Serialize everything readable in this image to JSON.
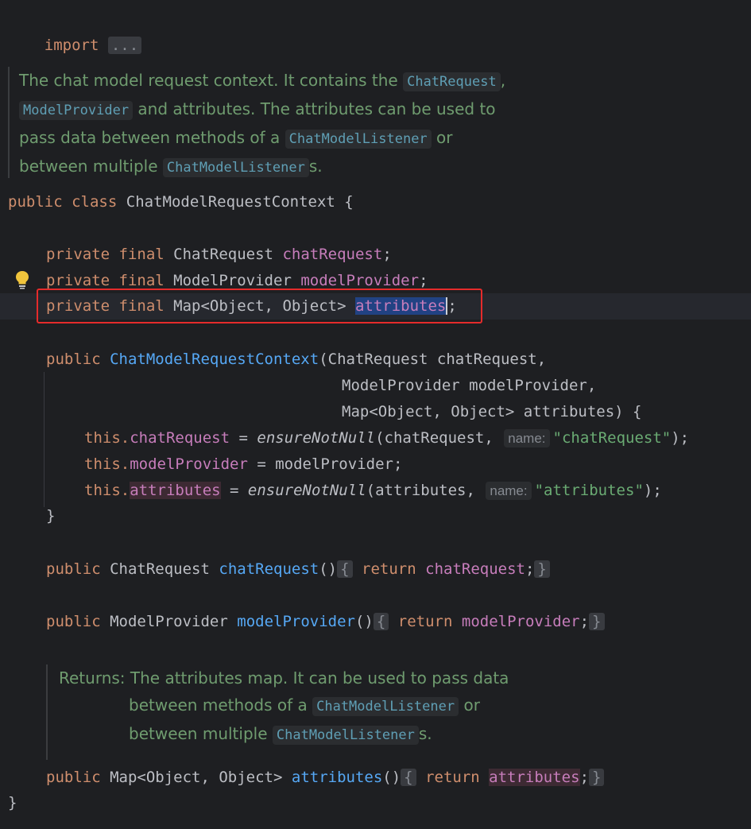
{
  "import": {
    "keyword": "import",
    "fold": "..."
  },
  "class_doc": {
    "l1": "The chat model request context. It contains the ",
    "l1_ref": "ChatRequest",
    "l1_end": ",",
    "l2_ref": "ModelProvider",
    "l2": " and attributes. The attributes can be used to",
    "l3": "pass data between methods of a ",
    "l3_ref": "ChatModelListener",
    "l3_end": " or",
    "l4": "between multiple ",
    "l4_ref": "ChatModelListener",
    "l4_end": "s."
  },
  "class_decl": {
    "kw_public": "public",
    "kw_class": "class",
    "name": "ChatModelRequestContext",
    "brace": " {"
  },
  "fields": [
    {
      "mods": "private final",
      "type": "ChatRequest",
      "name": "chatRequest"
    },
    {
      "mods": "private final",
      "type": "ModelProvider",
      "name": "modelProvider"
    },
    {
      "mods": "private final",
      "type": "Map<Object, Object>",
      "name": "attributes"
    }
  ],
  "constructor": {
    "kw": "public",
    "name": "ChatModelRequestContext",
    "p1": "(ChatRequest chatRequest,",
    "p2": "ModelProvider modelProvider,",
    "p3": "Map<Object, Object> attributes) {",
    "this": "this.",
    "s1_field": "chatRequest",
    "s1_mid": " = ",
    "s1_call": "ensureNotNull",
    "s1_args": "(chatRequest, ",
    "hint": "name:",
    "s1_str": "\"chatRequest\"",
    "s1_end": ");",
    "s2_field": "modelProvider",
    "s2_rest": " = modelProvider;",
    "s3_field": "attributes",
    "s3_mid": " = ",
    "s3_call": "ensureNotNull",
    "s3_args": "(attributes, ",
    "s3_str": "\"attributes\"",
    "s3_end": ");",
    "close": "}"
  },
  "getters": [
    {
      "kw": "public",
      "type": "ChatRequest",
      "name": "chatRequest",
      "parens": "()",
      "open": "{",
      "ret": "return",
      "field": "chatRequest",
      "semi": ";",
      "close": "}"
    },
    {
      "kw": "public",
      "type": "ModelProvider",
      "name": "modelProvider",
      "parens": "()",
      "open": "{",
      "ret": "return",
      "field": "modelProvider",
      "semi": ";",
      "close": "}"
    },
    {
      "kw": "public",
      "type": "Map<Object, Object>",
      "name": "attributes",
      "parens": "()",
      "open": "{",
      "ret": "return",
      "field": "attributes",
      "semi": ";",
      "close": "}"
    }
  ],
  "attr_doc": {
    "label": "Returns:",
    "l1": "The attributes map. It can be used to pass data",
    "l2": "between methods of a ",
    "l2_ref": "ChatModelListener",
    "l2_end": " or",
    "l3": "between multiple ",
    "l3_ref": "ChatModelListener",
    "l3_end": "s."
  },
  "class_close": "}",
  "colors": {
    "background": "#1e1f22",
    "keyword": "#cf8e6d",
    "field": "#c77dbb",
    "method": "#56a8f5",
    "string": "#6aab73",
    "doc": "#6f9c6f",
    "highlight_box": "#e52b2b"
  }
}
